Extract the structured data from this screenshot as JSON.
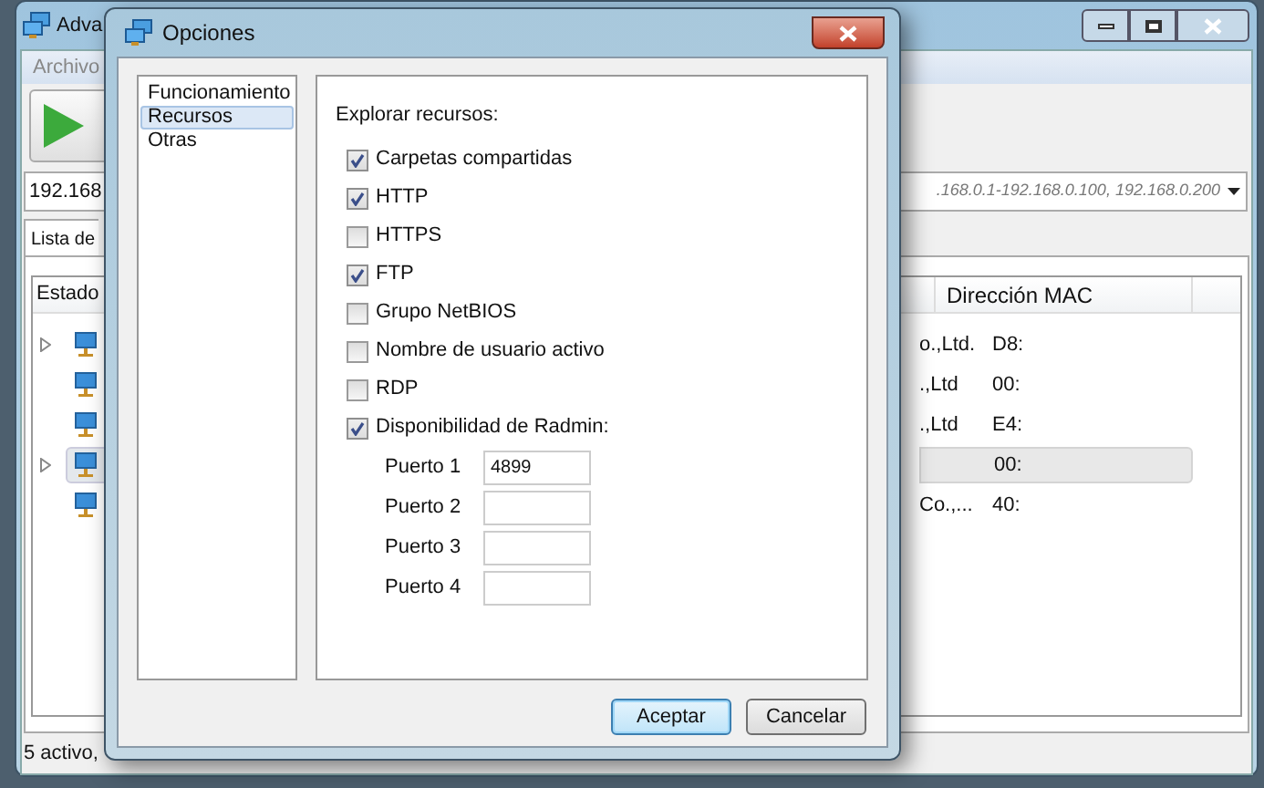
{
  "main_window": {
    "title": "Adva",
    "menu": [
      "Archivo"
    ],
    "address": {
      "value": "192.168",
      "range": ".168.0.1-192.168.0.100, 192.168.0.200"
    },
    "tab": "Lista de",
    "columns": {
      "first": "Estado",
      "mac": "Dirección MAC"
    },
    "rows": [
      {
        "expandable": true,
        "selected": false,
        "vendor": "o.,Ltd.",
        "mac": "D8:"
      },
      {
        "expandable": false,
        "selected": false,
        "vendor": ".,Ltd",
        "mac": "00:"
      },
      {
        "expandable": false,
        "selected": false,
        "vendor": ".,Ltd",
        "mac": "E4:"
      },
      {
        "expandable": true,
        "selected": true,
        "mac": "00:"
      },
      {
        "expandable": false,
        "selected": false,
        "vendor": "Co.,...",
        "mac": "40:"
      }
    ],
    "status": "5 activo,"
  },
  "dialog": {
    "title": "Opciones",
    "nav": [
      {
        "label": "Funcionamiento",
        "selected": false
      },
      {
        "label": "Recursos",
        "selected": true
      },
      {
        "label": "Otras",
        "selected": false
      }
    ],
    "section": "Explorar recursos:",
    "options": [
      {
        "label": "Carpetas compartidas",
        "checked": true
      },
      {
        "label": "HTTP",
        "checked": true
      },
      {
        "label": "HTTPS",
        "checked": false
      },
      {
        "label": "FTP",
        "checked": true
      },
      {
        "label": "Grupo NetBIOS",
        "checked": false
      },
      {
        "label": "Nombre de usuario activo",
        "checked": false
      },
      {
        "label": "RDP",
        "checked": false
      },
      {
        "label": "Disponibilidad de Radmin:",
        "checked": true
      }
    ],
    "ports": [
      {
        "label": "Puerto 1",
        "value": "4899"
      },
      {
        "label": "Puerto 2"
      },
      {
        "label": "Puerto 3"
      },
      {
        "label": "Puerto 4"
      }
    ],
    "buttons": [
      {
        "label": "Aceptar",
        "default": true
      },
      {
        "label": "Cancelar",
        "default": false
      }
    ]
  }
}
